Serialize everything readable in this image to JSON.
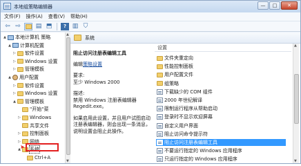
{
  "window": {
    "title": "本地组策略编辑器",
    "controls": [
      "—",
      "□",
      "✕"
    ]
  },
  "menu": [
    "文件(F)",
    "操作(A)",
    "查看(V)",
    "帮助(H)"
  ],
  "toolbar": [
    "back-icon",
    "forward-icon",
    "folder-icon",
    "tree-icon",
    "export-icon",
    "help-icon",
    "view-icon",
    "filter-icon"
  ],
  "tree": {
    "items": [
      {
        "label": "本地计算机 策略",
        "level": 0,
        "arrow": "▲",
        "icon": "pc"
      },
      {
        "label": "计算机配置",
        "level": 1,
        "arrow": "▲",
        "icon": "pc"
      },
      {
        "label": "软件设置",
        "level": 2,
        "arrow": "▷",
        "icon": "folder"
      },
      {
        "label": "Windows 设置",
        "level": 2,
        "arrow": "▷",
        "icon": "folder"
      },
      {
        "label": "管理模板",
        "level": 2,
        "arrow": "▷",
        "icon": "folder"
      },
      {
        "label": "用户配置",
        "level": 1,
        "arrow": "▲",
        "icon": "user"
      },
      {
        "label": "软件设置",
        "level": 2,
        "arrow": "▷",
        "icon": "folder"
      },
      {
        "label": "Windows 设置",
        "level": 2,
        "arrow": "▷",
        "icon": "folder"
      },
      {
        "label": "管理模板",
        "level": 2,
        "arrow": "▲",
        "icon": "folder"
      },
      {
        "label": "\"开始\"菜",
        "level": 3,
        "arrow": "",
        "icon": "folder"
      },
      {
        "label": "Windows",
        "level": 3,
        "arrow": "▷",
        "icon": "folder"
      },
      {
        "label": "共享文件",
        "level": 3,
        "arrow": "",
        "icon": "folder"
      },
      {
        "label": "控制面板",
        "level": 3,
        "arrow": "▷",
        "icon": "folder"
      },
      {
        "label": "网络",
        "level": 3,
        "arrow": "▷",
        "icon": "folder"
      },
      {
        "label": "系统",
        "level": 3,
        "arrow": "▲",
        "icon": "folder",
        "selected": true
      },
      {
        "label": "Ctrl+A",
        "level": 4,
        "arrow": "",
        "icon": "folder"
      }
    ]
  },
  "main": {
    "header": "系统",
    "desc": {
      "title": "阻止访问注册表编辑工具",
      "edit_prefix": "编辑",
      "edit_link": "策略设置",
      "req_label": "要求:",
      "req_value": "至少 Windows 2000",
      "desc_label": "描述:",
      "desc_text": "禁用 Windows 注册表编辑器 Regedit.exe。",
      "enabled_text": "如果启用此设置，并且用户试图启动注册表编辑器，则会出现一条消息，说明设置会阻止此操作。"
    },
    "list_header": "设置",
    "items": [
      {
        "label": "文件夹重定向",
        "icon": "folder"
      },
      {
        "label": "性能控制面板",
        "icon": "folder"
      },
      {
        "label": "用户配置文件",
        "icon": "folder"
      },
      {
        "label": "组策略",
        "icon": "folder"
      },
      {
        "label": "下载缺少的 COM 组件",
        "icon": "policy"
      },
      {
        "label": "2000 年世纪解译",
        "icon": "policy"
      },
      {
        "label": "限制运行程序从帮助启动",
        "icon": "policy"
      },
      {
        "label": "登录时不显示欢迎屏幕",
        "icon": "policy"
      },
      {
        "label": "自定义用户界面",
        "icon": "policy"
      },
      {
        "label": "阻止访问命令提示符",
        "icon": "policy"
      },
      {
        "label": "阻止访问注册表编辑工具",
        "icon": "policy",
        "highlighted": true
      },
      {
        "label": "不要运行指定的 Windows 应用程序",
        "icon": "policy"
      },
      {
        "label": "只运行指定的 Windows 应用程序",
        "icon": "policy"
      }
    ]
  },
  "colors": {
    "selection": "#3399ff",
    "annotation": "#e21f1f"
  }
}
